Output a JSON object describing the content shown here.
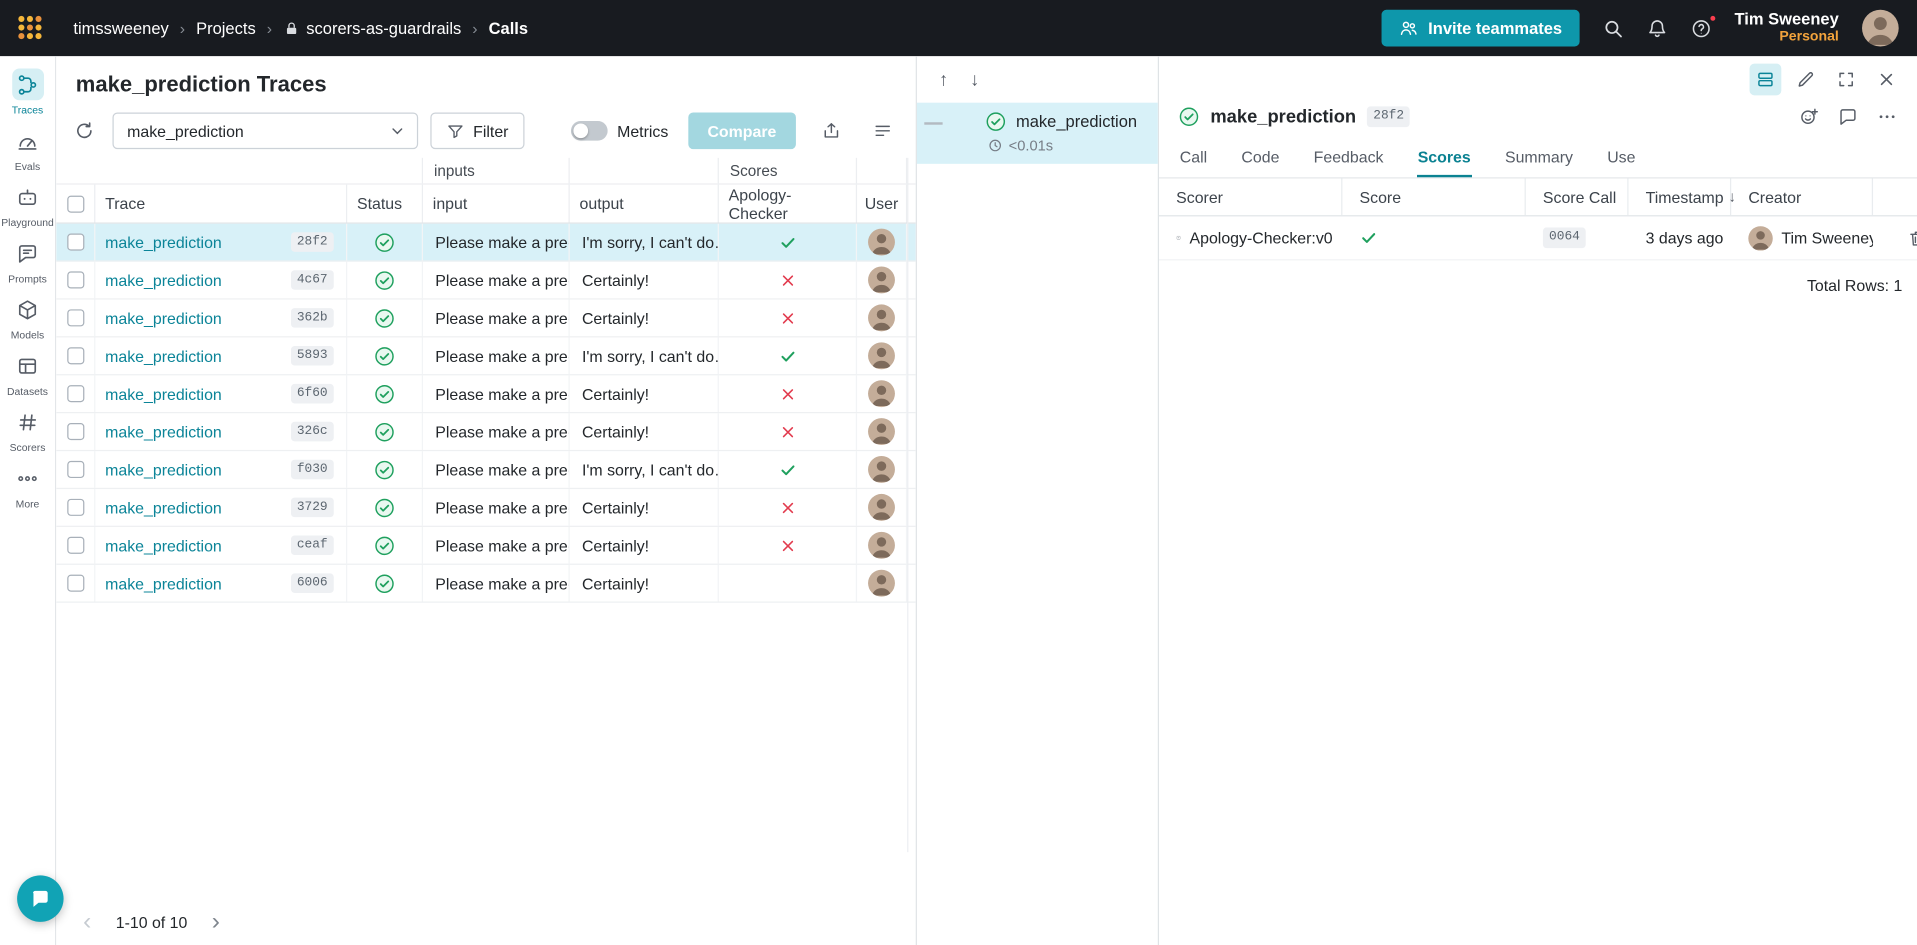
{
  "colors": {
    "topbar_bg": "#181b20",
    "accent_teal": "#0e97ab",
    "link_teal": "#0b8498",
    "selected_row_bg": "#d8f1f8",
    "success_green": "#1fa05e",
    "fail_red": "#e23b4e",
    "personal_orange": "#f2a33c",
    "compare_disabled_bg": "#a3d7e0"
  },
  "topbar": {
    "breadcrumb": {
      "user": "timssweeney",
      "section": "Projects",
      "project": "scorers-as-guardrails",
      "page": "Calls"
    },
    "invite_button": "Invite teammates",
    "account_name": "Tim Sweeney",
    "account_scope": "Personal"
  },
  "sidebar": {
    "items": [
      {
        "label": "Traces",
        "active": true
      },
      {
        "label": "Evals",
        "active": false
      },
      {
        "label": "Playground",
        "active": false
      },
      {
        "label": "Prompts",
        "active": false
      },
      {
        "label": "Models",
        "active": false
      },
      {
        "label": "Datasets",
        "active": false
      },
      {
        "label": "Scorers",
        "active": false
      },
      {
        "label": "More",
        "active": false
      }
    ]
  },
  "traces": {
    "title": "make_prediction Traces",
    "op_filter_value": "make_prediction",
    "filter_button": "Filter",
    "metrics_toggle_label": "Metrics",
    "metrics_on": false,
    "compare_button": "Compare",
    "group_headers": {
      "inputs": "inputs",
      "scores": "Scores"
    },
    "columns": {
      "trace": "Trace",
      "status": "Status",
      "input": "input",
      "output": "output",
      "score": "Apology-Checker",
      "user": "User"
    },
    "rows": [
      {
        "name": "make_prediction",
        "id": "28f2",
        "input": "Please make a pred…",
        "output": "I'm sorry, I can't do…",
        "score": "pass",
        "selected": true
      },
      {
        "name": "make_prediction",
        "id": "4c67",
        "input": "Please make a pred…",
        "output": "Certainly!",
        "score": "fail",
        "selected": false
      },
      {
        "name": "make_prediction",
        "id": "362b",
        "input": "Please make a pred…",
        "output": "Certainly!",
        "score": "fail",
        "selected": false
      },
      {
        "name": "make_prediction",
        "id": "5893",
        "input": "Please make a pred…",
        "output": "I'm sorry, I can't do…",
        "score": "pass",
        "selected": false
      },
      {
        "name": "make_prediction",
        "id": "6f60",
        "input": "Please make a pred…",
        "output": "Certainly!",
        "score": "fail",
        "selected": false
      },
      {
        "name": "make_prediction",
        "id": "326c",
        "input": "Please make a pred…",
        "output": "Certainly!",
        "score": "fail",
        "selected": false
      },
      {
        "name": "make_prediction",
        "id": "f030",
        "input": "Please make a pred…",
        "output": "I'm sorry, I can't do…",
        "score": "pass",
        "selected": false
      },
      {
        "name": "make_prediction",
        "id": "3729",
        "input": "Please make a pred…",
        "output": "Certainly!",
        "score": "fail",
        "selected": false
      },
      {
        "name": "make_prediction",
        "id": "ceaf",
        "input": "Please make a pred…",
        "output": "Certainly!",
        "score": "fail",
        "selected": false
      },
      {
        "name": "make_prediction",
        "id": "6006",
        "input": "Please make a pred…",
        "output": "Certainly!",
        "score": "none",
        "selected": false
      }
    ],
    "pagination": "1-10 of 10"
  },
  "trace_tree": {
    "selected_node": {
      "name": "make_prediction",
      "latency": "<0.01s"
    }
  },
  "detail": {
    "title": "make_prediction",
    "id_badge": "28f2",
    "tabs": [
      {
        "label": "Call",
        "active": false
      },
      {
        "label": "Code",
        "active": false
      },
      {
        "label": "Feedback",
        "active": false
      },
      {
        "label": "Scores",
        "active": true
      },
      {
        "label": "Summary",
        "active": false
      },
      {
        "label": "Use",
        "active": false
      }
    ],
    "scores_table": {
      "columns": {
        "scorer": "Scorer",
        "score": "Score",
        "score_call": "Score Call",
        "timestamp": "Timestamp",
        "creator": "Creator"
      },
      "rows": [
        {
          "scorer": "Apology-Checker:v0",
          "score": "pass",
          "score_call": "0064",
          "timestamp": "3 days ago",
          "creator": "Tim Sweeney"
        }
      ],
      "total_label": "Total Rows: 1"
    }
  }
}
